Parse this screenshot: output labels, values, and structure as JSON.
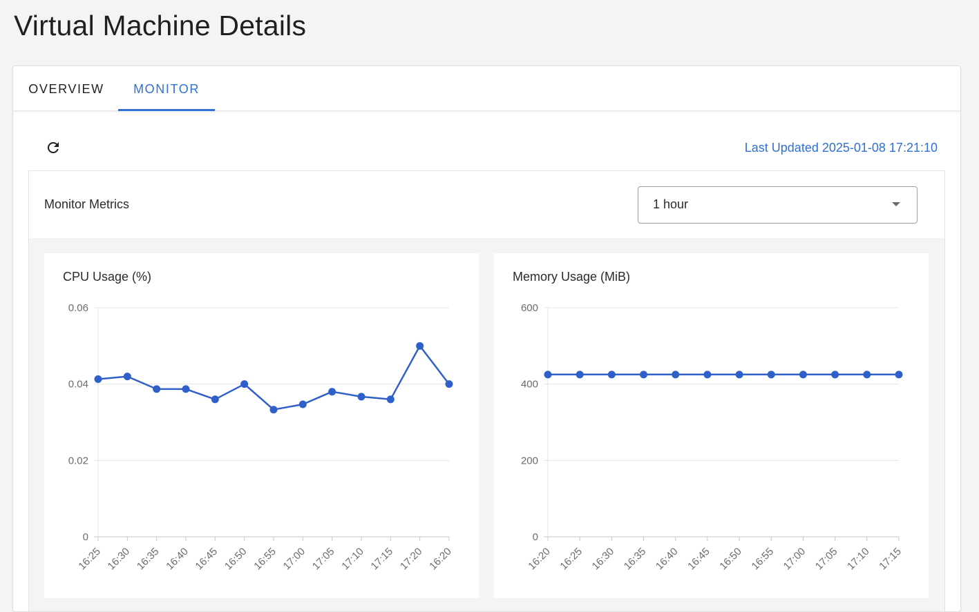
{
  "page": {
    "title": "Virtual Machine Details"
  },
  "tabs": [
    {
      "label": "OVERVIEW",
      "active": false
    },
    {
      "label": "MONITOR",
      "active": true
    }
  ],
  "toolbar": {
    "refresh_icon": "refresh-icon",
    "last_updated": "Last Updated 2025-01-08 17:21:10"
  },
  "metrics": {
    "title": "Monitor Metrics",
    "range_select": {
      "value": "1 hour",
      "icon": "chevron-down-icon"
    }
  },
  "colors": {
    "accent": "#2f6fd6",
    "series": "#2f5fc9",
    "grid": "#e3e3e3",
    "axis": "#c8c8c8"
  },
  "chart_data": [
    {
      "type": "line",
      "title": "CPU Usage (%)",
      "xlabel": "",
      "ylabel": "",
      "x": [
        "16:25",
        "16:30",
        "16:35",
        "16:40",
        "16:45",
        "16:50",
        "16:55",
        "17:00",
        "17:05",
        "17:10",
        "17:15",
        "17:20",
        "16:20"
      ],
      "series": [
        {
          "values": [
            0.0413,
            0.042,
            0.0387,
            0.0387,
            0.036,
            0.04,
            0.0333,
            0.0347,
            0.038,
            0.0367,
            0.036,
            0.05,
            0.04
          ]
        }
      ],
      "ylim": [
        0,
        0.06
      ],
      "yticks": [
        "0",
        "0.02",
        "0.04",
        "0.06"
      ],
      "ytick_values": [
        0,
        0.02,
        0.04,
        0.06
      ],
      "grid": true
    },
    {
      "type": "line",
      "title": "Memory Usage (MiB)",
      "xlabel": "",
      "ylabel": "",
      "x": [
        "16:20",
        "16:25",
        "16:30",
        "16:35",
        "16:40",
        "16:45",
        "16:50",
        "16:55",
        "17:00",
        "17:05",
        "17:10",
        "17:15"
      ],
      "series": [
        {
          "values": [
            425,
            425,
            425,
            425,
            425,
            425,
            425,
            425,
            425,
            425,
            425,
            425
          ]
        }
      ],
      "ylim": [
        0,
        600
      ],
      "yticks": [
        "0",
        "200",
        "400",
        "600"
      ],
      "ytick_values": [
        0,
        200,
        400,
        600
      ],
      "grid": true
    }
  ]
}
